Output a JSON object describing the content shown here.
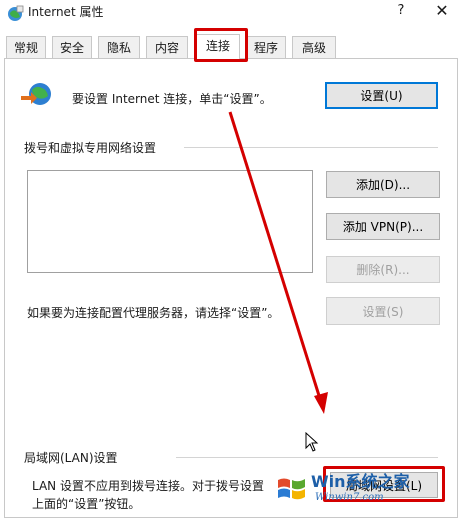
{
  "window": {
    "title": "Internet 属性",
    "help": "?",
    "close": "✕"
  },
  "tabs": [
    {
      "label": "常规"
    },
    {
      "label": "安全"
    },
    {
      "label": "隐私"
    },
    {
      "label": "内容"
    },
    {
      "label": "连接",
      "active": true
    },
    {
      "label": "程序"
    },
    {
      "label": "高级"
    }
  ],
  "setup": {
    "text": "要设置 Internet 连接，单击“设置”。",
    "button": "设置(U)"
  },
  "dialup": {
    "heading": "拨号和虚拟专用网络设置",
    "add_button": "添加(D)...",
    "add_vpn_button": "添加 VPN(P)...",
    "delete_button": "删除(R)...",
    "proxy_text": "如果要为连接配置代理服务器，请选择“设置”。",
    "settings_button": "设置(S)"
  },
  "lan": {
    "heading": "局域网(LAN)设置",
    "text_line1": "LAN 设置不应用到拨号连接。对于拨号设置",
    "text_line2": "上面的“设置”按钮。",
    "button": "局域网设置(L)"
  },
  "watermark": {
    "brand": "Win系统之家",
    "url": "Winwin7.com"
  },
  "colors": {
    "annotation": "#d40000",
    "accent": "#0078d7"
  }
}
